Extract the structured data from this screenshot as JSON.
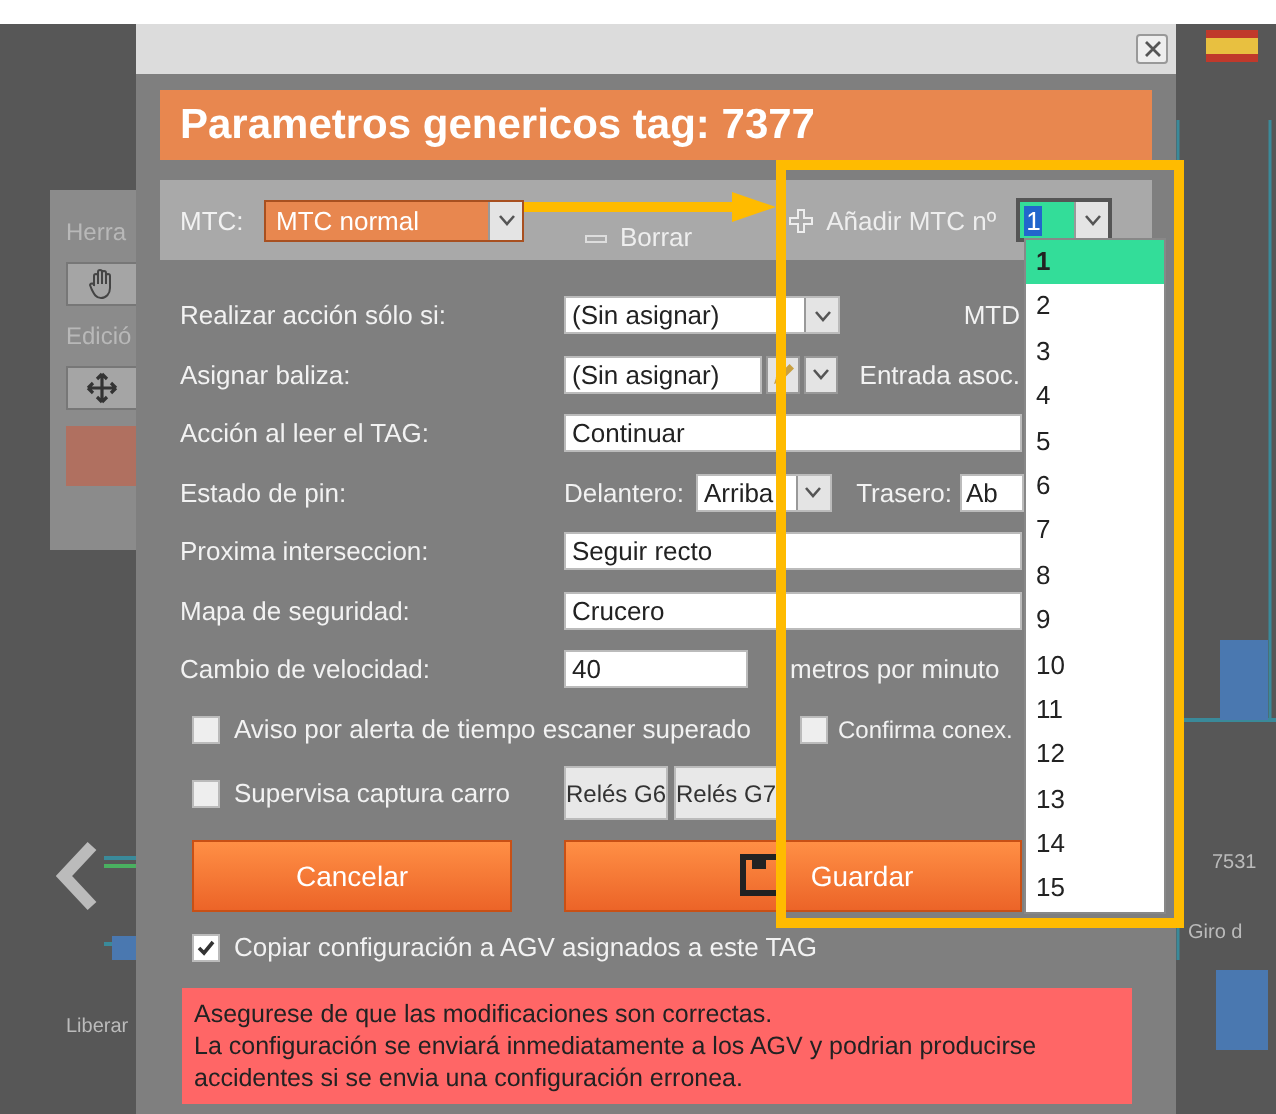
{
  "background": {
    "panel_title": "Herra",
    "section_title": "Edició",
    "map_labels": [
      {
        "text": "7531"
      },
      {
        "text": "Giro d"
      },
      {
        "text": "Liberar"
      }
    ]
  },
  "dialog": {
    "title": "Parametros genericos tag: 7377"
  },
  "mtc_bar": {
    "label": "MTC:",
    "mtc_select": "MTC normal",
    "delete_button": "Borrar",
    "add_label": "Añadir MTC nº",
    "number_select": "1"
  },
  "number_options": [
    {
      "label": "1",
      "selected": true
    },
    {
      "label": "2",
      "selected": false
    },
    {
      "label": "3",
      "selected": false
    },
    {
      "label": "4",
      "selected": false
    },
    {
      "label": "5",
      "selected": false
    },
    {
      "label": "6",
      "selected": false
    },
    {
      "label": "7",
      "selected": false
    },
    {
      "label": "8",
      "selected": false
    },
    {
      "label": "9",
      "selected": false
    },
    {
      "label": "10",
      "selected": false
    },
    {
      "label": "11",
      "selected": false
    },
    {
      "label": "12",
      "selected": false
    },
    {
      "label": "13",
      "selected": false
    },
    {
      "label": "14",
      "selected": false
    },
    {
      "label": "15",
      "selected": false
    }
  ],
  "rows": [
    {
      "kind": "select",
      "label": "Realizar acción sólo si:",
      "value": "(Sin asignar)",
      "side_label": "MTD"
    },
    {
      "kind": "select_edit",
      "label": "Asignar baliza:",
      "value": "(Sin asignar)",
      "side_label": "Entrada asoc."
    },
    {
      "kind": "text",
      "label": "Acción al leer el TAG:",
      "value": "Continuar"
    },
    {
      "kind": "pin",
      "label": "Estado de pin:",
      "front_label": "Delantero:",
      "front_value": "Arriba",
      "rear_label": "Trasero:",
      "rear_value": "Ab"
    },
    {
      "kind": "text",
      "label": "Proxima interseccion:",
      "value": "Seguir recto"
    },
    {
      "kind": "text",
      "label": "Mapa de seguridad:",
      "value": "Crucero"
    },
    {
      "kind": "number",
      "label": "Cambio de velocidad:",
      "value": "40",
      "unit": "metros por minuto"
    }
  ],
  "checkboxes": [
    {
      "label": "Aviso por alerta de tiempo escaner superado",
      "checked": false
    },
    {
      "label": "Confirma conex.",
      "checked": false
    }
  ],
  "relay_row": {
    "checkbox": {
      "label": "Supervisa captura carro",
      "checked": false
    },
    "buttons": [
      "Relés G6",
      "Relés G7"
    ]
  },
  "actions": {
    "cancel": "Cancelar",
    "save": "Guardar"
  },
  "copy_checkbox": {
    "label": "Copiar configuración a AGV asignados a este TAG",
    "checked": true
  },
  "warning": "Asegurese de que las modificaciones son correctas.\nLa configuración se enviará inmediatamente a los AGV y podrian producirse accidentes si se envia una configuración erronea."
}
